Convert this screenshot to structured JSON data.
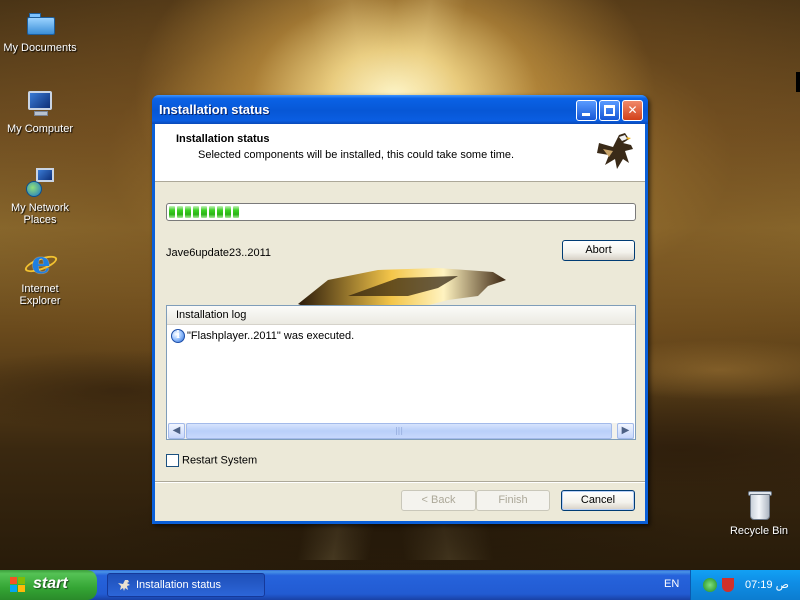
{
  "desktop": {
    "icons": [
      {
        "label": "My Documents",
        "icon": "my-documents-icon"
      },
      {
        "label": "My Computer",
        "icon": "my-computer-icon"
      },
      {
        "label": "My Network Places",
        "icon": "network-places-icon"
      },
      {
        "label": "Internet Explorer",
        "icon": "internet-explorer-icon"
      },
      {
        "label": "Recycle Bin",
        "icon": "recycle-bin-icon"
      }
    ]
  },
  "window": {
    "title": "Installation status",
    "header_title": "Installation status",
    "header_subtitle": "Selected components will be installed, this could take some time.",
    "progress_fraction": 0.17,
    "current_item": "Jave6update23..2011",
    "abort_label": "Abort",
    "log": {
      "header": "Installation log",
      "entries": [
        {
          "icon": "info-icon",
          "text": "\"Flashplayer..2011\" was executed."
        }
      ]
    },
    "restart_label": "Restart System",
    "restart_checked": false,
    "back_label": "< Back",
    "finish_label": "Finish",
    "cancel_label": "Cancel"
  },
  "taskbar": {
    "start_label": "start",
    "task_item": "Installation status",
    "language": "EN",
    "clock": "07:19 ص"
  }
}
